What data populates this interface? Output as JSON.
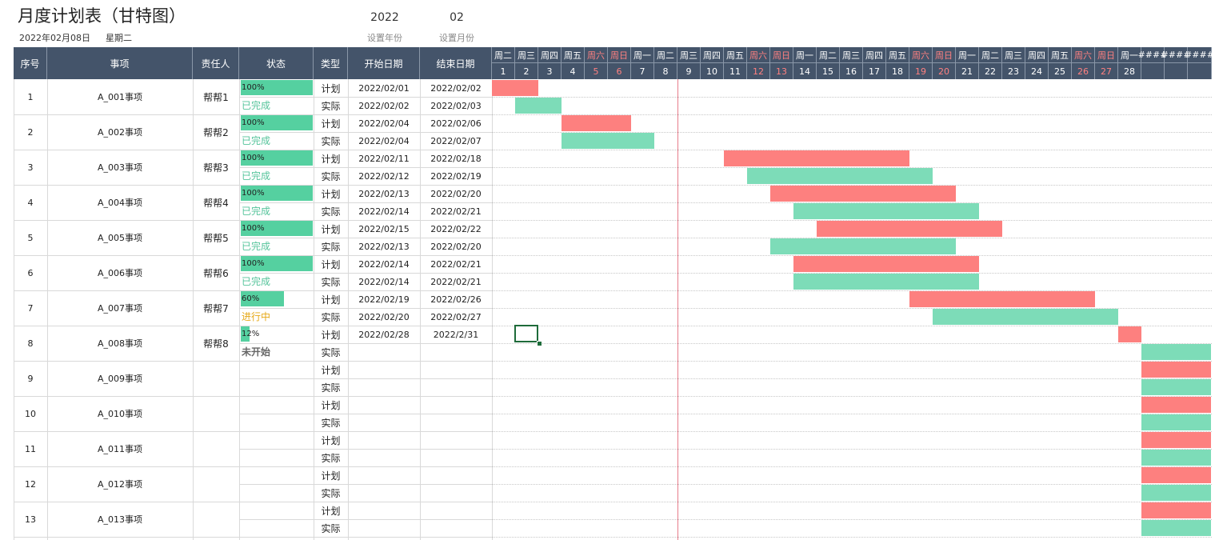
{
  "header": {
    "title": "月度计划表（甘特图）",
    "date": "2022年02月08日",
    "weekday": "星期二",
    "year_value": "2022",
    "year_label": "设置年份",
    "month_value": "02",
    "month_label": "设置月份"
  },
  "columns": [
    "序号",
    "事项",
    "责任人",
    "状态",
    "类型",
    "开始日期",
    "结束日期"
  ],
  "day_headers": {
    "weekdays": [
      "周二",
      "周三",
      "周四",
      "周五",
      "周六",
      "周日",
      "周一",
      "周二",
      "周三",
      "周四",
      "周五",
      "周六",
      "周日",
      "周一",
      "周二",
      "周三",
      "周四",
      "周五",
      "周六",
      "周日",
      "周一",
      "周二",
      "周三",
      "周四",
      "周五",
      "周六",
      "周日",
      "周一",
      "####",
      "####",
      "####"
    ],
    "days": [
      "1",
      "2",
      "3",
      "4",
      "5",
      "6",
      "7",
      "8",
      "9",
      "10",
      "11",
      "12",
      "13",
      "14",
      "15",
      "16",
      "17",
      "18",
      "19",
      "20",
      "21",
      "22",
      "23",
      "24",
      "25",
      "26",
      "27",
      "28",
      "",
      "",
      ""
    ],
    "weekend_indexes": [
      4,
      5,
      11,
      12,
      18,
      19,
      25,
      26
    ]
  },
  "type_labels": {
    "plan": "计划",
    "actual": "实际"
  },
  "rows": [
    {
      "no": "1",
      "item": "A_001事项",
      "owner": "帮帮1",
      "progress": 100,
      "progress_text": "100%",
      "status": "已完成",
      "status_color": "#55c49b",
      "plan_start": "2022/02/01",
      "plan_end": "2022/02/02",
      "act_start": "2022/02/02",
      "act_end": "2022/02/03",
      "plan_bar": [
        1,
        2
      ],
      "act_bar": [
        2,
        3
      ]
    },
    {
      "no": "2",
      "item": "A_002事项",
      "owner": "帮帮2",
      "progress": 100,
      "progress_text": "100%",
      "status": "已完成",
      "status_color": "#55c49b",
      "plan_start": "2022/02/04",
      "plan_end": "2022/02/06",
      "act_start": "2022/02/04",
      "act_end": "2022/02/07",
      "plan_bar": [
        4,
        6
      ],
      "act_bar": [
        4,
        7
      ]
    },
    {
      "no": "3",
      "item": "A_003事项",
      "owner": "帮帮3",
      "progress": 100,
      "progress_text": "100%",
      "status": "已完成",
      "status_color": "#55c49b",
      "plan_start": "2022/02/11",
      "plan_end": "2022/02/18",
      "act_start": "2022/02/12",
      "act_end": "2022/02/19",
      "plan_bar": [
        11,
        18
      ],
      "act_bar": [
        12,
        19
      ]
    },
    {
      "no": "4",
      "item": "A_004事项",
      "owner": "帮帮4",
      "progress": 100,
      "progress_text": "100%",
      "status": "已完成",
      "status_color": "#55c49b",
      "plan_start": "2022/02/13",
      "plan_end": "2022/02/20",
      "act_start": "2022/02/14",
      "act_end": "2022/02/21",
      "plan_bar": [
        13,
        20
      ],
      "act_bar": [
        14,
        21
      ]
    },
    {
      "no": "5",
      "item": "A_005事项",
      "owner": "帮帮5",
      "progress": 100,
      "progress_text": "100%",
      "status": "已完成",
      "status_color": "#55c49b",
      "plan_start": "2022/02/15",
      "plan_end": "2022/02/22",
      "act_start": "2022/02/13",
      "act_end": "2022/02/20",
      "plan_bar": [
        15,
        22
      ],
      "act_bar": [
        13,
        20
      ]
    },
    {
      "no": "6",
      "item": "A_006事项",
      "owner": "帮帮6",
      "progress": 100,
      "progress_text": "100%",
      "status": "已完成",
      "status_color": "#55c49b",
      "plan_start": "2022/02/14",
      "plan_end": "2022/02/21",
      "act_start": "2022/02/14",
      "act_end": "2022/02/21",
      "plan_bar": [
        14,
        21
      ],
      "act_bar": [
        14,
        21
      ]
    },
    {
      "no": "7",
      "item": "A_007事项",
      "owner": "帮帮7",
      "progress": 60,
      "progress_text": "60%",
      "status": "进行中",
      "status_color": "#e6a817",
      "plan_start": "2022/02/19",
      "plan_end": "2022/02/26",
      "act_start": "2022/02/20",
      "act_end": "2022/02/27",
      "plan_bar": [
        19,
        26
      ],
      "act_bar": [
        20,
        27
      ]
    },
    {
      "no": "8",
      "item": "A_008事项",
      "owner": "帮帮8",
      "progress": 12,
      "progress_text": "12%",
      "status": "未开始",
      "status_color": "#666666",
      "plan_start": "2022/02/28",
      "plan_end": "2022/2/31",
      "act_start": "",
      "act_end": "",
      "plan_bar": [
        28,
        28
      ],
      "act_bar": [
        29,
        31
      ]
    },
    {
      "no": "9",
      "item": "A_009事项",
      "owner": "",
      "progress": null,
      "progress_text": "",
      "status": "",
      "status_color": "#666666",
      "plan_start": "",
      "plan_end": "",
      "act_start": "",
      "act_end": "",
      "plan_bar": [
        29,
        31
      ],
      "act_bar": [
        29,
        31
      ]
    },
    {
      "no": "10",
      "item": "A_010事项",
      "owner": "",
      "progress": null,
      "progress_text": "",
      "status": "",
      "status_color": "#666666",
      "plan_start": "",
      "plan_end": "",
      "act_start": "",
      "act_end": "",
      "plan_bar": [
        29,
        31
      ],
      "act_bar": [
        29,
        31
      ]
    },
    {
      "no": "11",
      "item": "A_011事项",
      "owner": "",
      "progress": null,
      "progress_text": "",
      "status": "",
      "status_color": "#666666",
      "plan_start": "",
      "plan_end": "",
      "act_start": "",
      "act_end": "",
      "plan_bar": [
        29,
        31
      ],
      "act_bar": [
        29,
        31
      ]
    },
    {
      "no": "12",
      "item": "A_012事项",
      "owner": "",
      "progress": null,
      "progress_text": "",
      "status": "",
      "status_color": "#666666",
      "plan_start": "",
      "plan_end": "",
      "act_start": "",
      "act_end": "",
      "plan_bar": [
        29,
        31
      ],
      "act_bar": [
        29,
        31
      ]
    },
    {
      "no": "13",
      "item": "A_013事项",
      "owner": "",
      "progress": null,
      "progress_text": "",
      "status": "",
      "status_color": "#666666",
      "plan_start": "",
      "plan_end": "",
      "act_start": "",
      "act_end": "",
      "plan_bar": [
        29,
        31
      ],
      "act_bar": [
        29,
        31
      ]
    }
  ],
  "colors": {
    "header_bg": "#44546a",
    "plan_bar": "#fd807f",
    "actual_bar": "#7ddcb8",
    "progress_bar": "#55d0a0",
    "weekend_text": "#ff8080",
    "today_line": "#e87d8c"
  }
}
